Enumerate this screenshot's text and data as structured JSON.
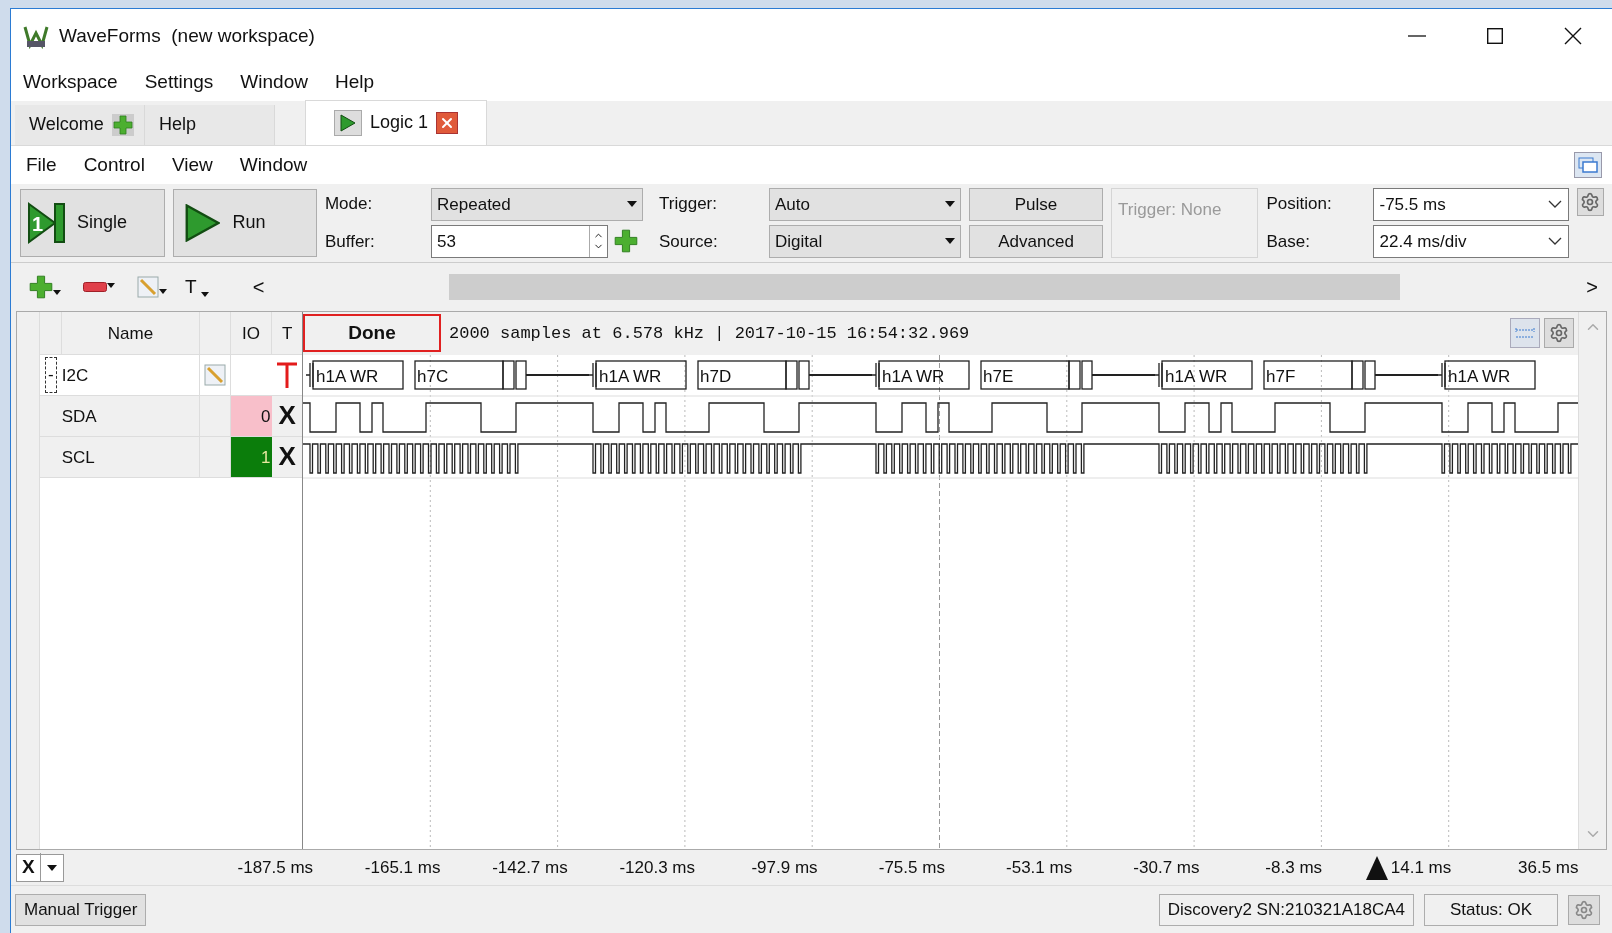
{
  "window": {
    "title": "WaveForms  (new workspace)"
  },
  "menu": [
    "Workspace",
    "Settings",
    "Window",
    "Help"
  ],
  "tabs": [
    {
      "label": "Welcome",
      "selected": false,
      "kind": "add"
    },
    {
      "label": "Help",
      "selected": false,
      "kind": "plain"
    },
    {
      "label": "Logic 1",
      "selected": true,
      "kind": "instrument"
    }
  ],
  "instrument_menu": [
    "File",
    "Control",
    "View",
    "Window"
  ],
  "controls": {
    "single": {
      "label": "Single",
      "icon_text": "1"
    },
    "run": {
      "label": "Run"
    },
    "mode": {
      "label": "Mode:",
      "value": "Repeated"
    },
    "buffer": {
      "label": "Buffer:",
      "value": "53"
    },
    "trigger": {
      "label": "Trigger:",
      "value": "Auto"
    },
    "source": {
      "label": "Source:",
      "value": "Digital"
    },
    "pulse": "Pulse",
    "advanced": "Advanced",
    "trigger_status": {
      "text": "Trigger: None",
      "disabled": true
    },
    "position": {
      "label": "Position:",
      "value": "-75.5 ms"
    },
    "base": {
      "label": "Base:",
      "value": "22.4 ms/div"
    }
  },
  "toolbar": {
    "text_tool": "T",
    "scroll_left": "<",
    "scroll_right": ">"
  },
  "signals": {
    "columns": [
      "Name",
      "IO",
      "T"
    ],
    "status": "Done",
    "info": "2000 samples at 6.578 kHz | 2017-10-15 16:54:32.969",
    "rows": [
      {
        "kind": "bus",
        "toggle": "-",
        "name": "I2C",
        "frames": [
          {
            "address": "h1A WR",
            "data": "h7C"
          },
          {
            "address": "h1A WR",
            "data": "h7D"
          },
          {
            "address": "h1A WR",
            "data": "h7E"
          },
          {
            "address": "h1A WR",
            "data": "h7F"
          },
          {
            "address": "h1A WR"
          }
        ]
      },
      {
        "kind": "data",
        "name": "SDA",
        "io": "0",
        "io_high": false,
        "trigger": "X"
      },
      {
        "kind": "clock",
        "name": "SCL",
        "io": "1",
        "io_high": true,
        "trigger": "X"
      }
    ]
  },
  "axis": {
    "channel": "X",
    "ticks": [
      "-187.5 ms",
      "-165.1 ms",
      "-142.7 ms",
      "-120.3 ms",
      "-97.9 ms",
      "-75.5 ms",
      "-53.1 ms",
      "-30.7 ms",
      "-8.3 ms",
      "14.1 ms",
      "36.5 ms"
    ]
  },
  "status_bar": {
    "button": "Manual Trigger",
    "device": "Discovery2 SN:210321A18CA4",
    "status": "Status: OK"
  }
}
